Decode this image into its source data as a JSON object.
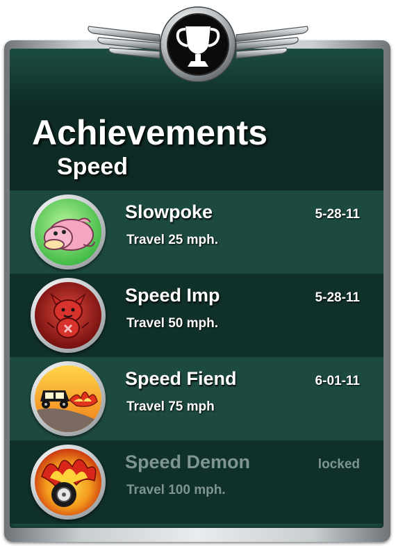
{
  "header": {
    "title": "Achievements",
    "subtitle": "Speed"
  },
  "emblem": {
    "icon": "trophy-icon"
  },
  "achievements": [
    {
      "name": "Slowpoke",
      "description": "Travel 25 mph.",
      "date": "5-28-11",
      "locked": false,
      "icon": "slowpoke-icon"
    },
    {
      "name": "Speed Imp",
      "description": "Travel 50 mph.",
      "date": "5-28-11",
      "locked": false,
      "icon": "imp-icon"
    },
    {
      "name": "Speed Fiend",
      "description": "Travel 75 mph",
      "date": "6-01-11",
      "locked": false,
      "icon": "flaming-car-icon"
    },
    {
      "name": "Speed Demon",
      "description": "Travel 100 mph.",
      "date": "locked",
      "locked": true,
      "icon": "flaming-wheel-icon"
    }
  ],
  "colors": {
    "panel": "#1b4a40",
    "row_light": "#1d4a40",
    "row_dark": "#10302a",
    "locked_text": "#7f9590"
  }
}
